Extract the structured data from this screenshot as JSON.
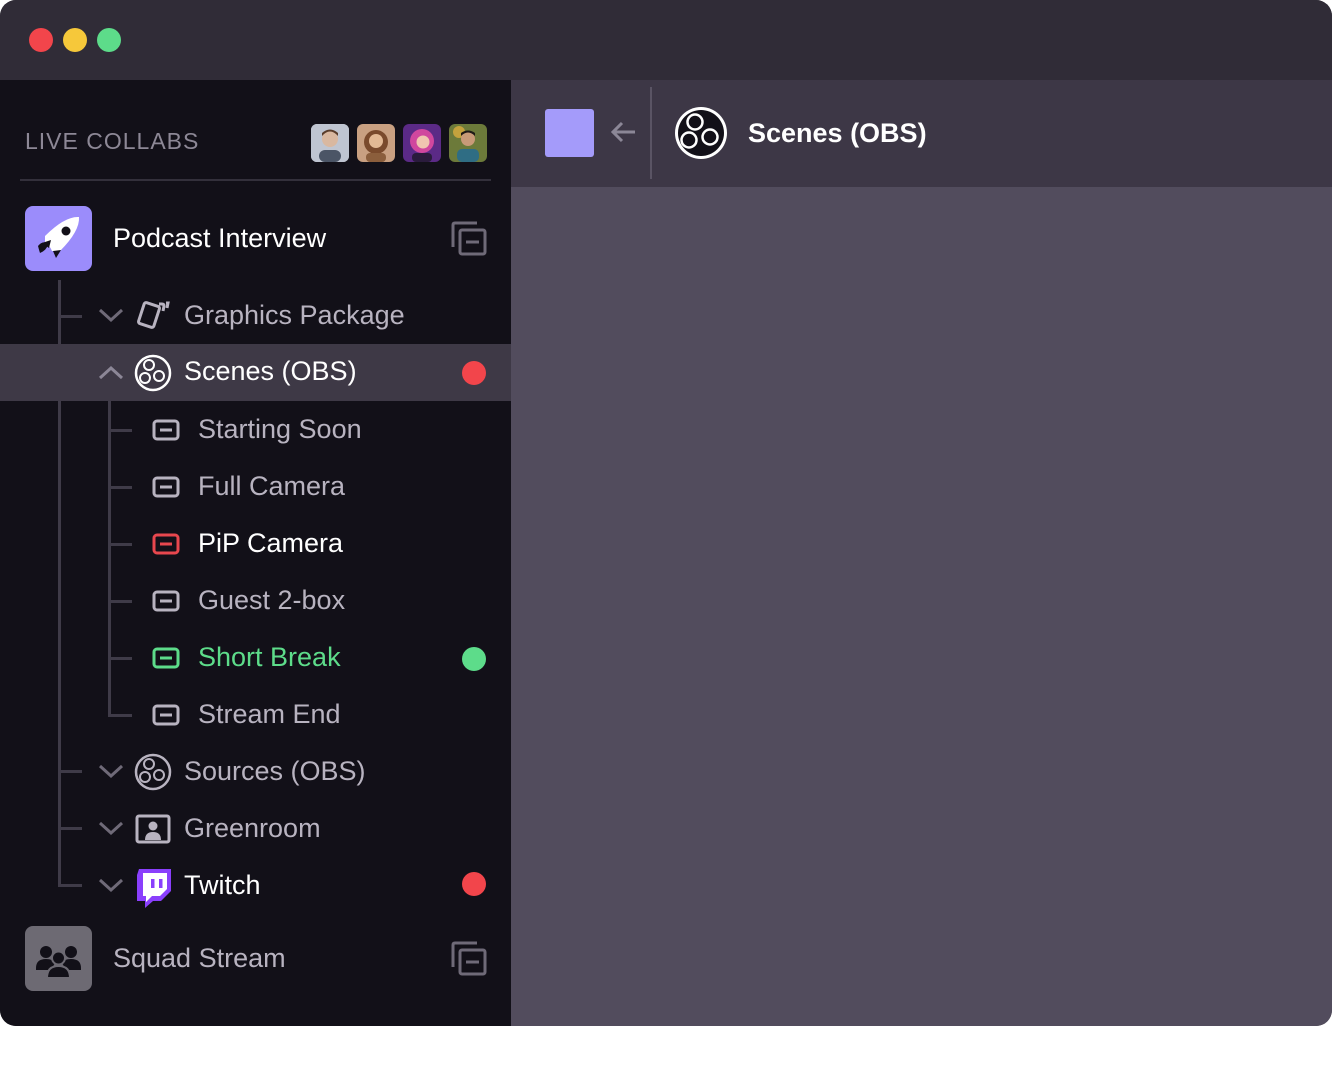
{
  "window": {
    "controls": [
      "close",
      "minimize",
      "maximize"
    ],
    "colors": {
      "close": "#f2454b",
      "minimize": "#f6c83a",
      "maximize": "#5ddc8a"
    }
  },
  "sidebar": {
    "section_label": "LIVE COLLABS",
    "collaborators": [
      {
        "name": "avatar-1",
        "color": "#9aa3b5"
      },
      {
        "name": "avatar-2",
        "color": "#b98a6a"
      },
      {
        "name": "avatar-3",
        "color": "#b04cc8"
      },
      {
        "name": "avatar-4",
        "color": "#5f7a46"
      }
    ],
    "projects": [
      {
        "title": "Podcast Interview",
        "icon": "rocket-icon",
        "accent": "#9b8cfb",
        "expanded": true
      },
      {
        "title": "Squad Stream",
        "icon": "group-icon",
        "accent": "#6d6a73",
        "expanded": false
      }
    ],
    "tree": [
      {
        "label": "Graphics Package",
        "icon": "cards-icon",
        "expanded": false
      },
      {
        "label": "Scenes (OBS)",
        "icon": "obs-icon",
        "expanded": true,
        "selected": true,
        "status": "red"
      },
      {
        "label": "Sources (OBS)",
        "icon": "obs-icon",
        "expanded": false
      },
      {
        "label": "Greenroom",
        "icon": "person-frame-icon",
        "expanded": false
      },
      {
        "label": "Twitch",
        "icon": "twitch-icon",
        "expanded": false,
        "status": "red"
      }
    ],
    "scenes": [
      {
        "label": "Starting Soon",
        "state": "normal"
      },
      {
        "label": "Full Camera",
        "state": "normal"
      },
      {
        "label": "PiP Camera",
        "state": "program"
      },
      {
        "label": "Guest 2-box",
        "state": "normal"
      },
      {
        "label": "Short Break",
        "state": "preview",
        "status": "green"
      },
      {
        "label": "Stream End",
        "state": "normal"
      }
    ]
  },
  "main": {
    "header": {
      "title": "Scenes (OBS)",
      "icon": "obs-icon",
      "swatch_color": "#a49bfa",
      "back_icon": "arrow-left-icon"
    }
  },
  "colors": {
    "status_red": "#f2454b",
    "status_green": "#5ddc8a",
    "program_red": "#e8474e",
    "preview_green": "#5ddc8a",
    "twitch_purple": "#8a3ffc"
  }
}
